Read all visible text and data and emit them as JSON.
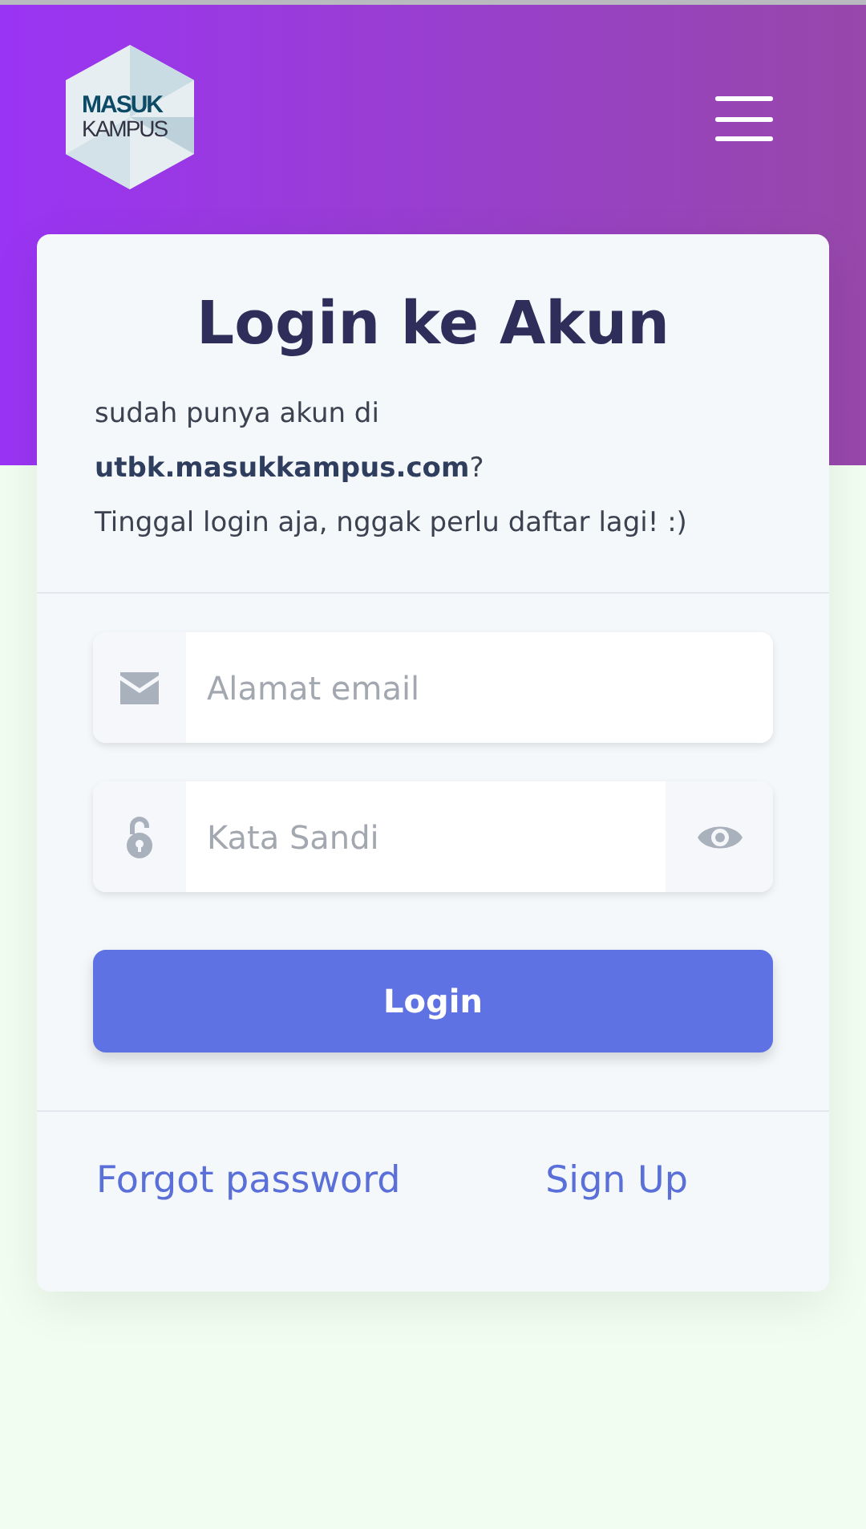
{
  "logo": {
    "lines": [
      "MASUK",
      "KAMPUS"
    ]
  },
  "title": "Login ke Akun",
  "intro": [
    "sudah punya akun di",
    "**utbk.masukkampus.com**?",
    "Tinggal login aja, nggak perlu daftar lagi! :)"
  ],
  "email_field": {
    "placeholder": "Alamat email"
  },
  "password_field": {
    "placeholder": "Kata Sandi"
  },
  "login_button": "Login",
  "links": [
    "Forgot password",
    "Sign Up"
  ]
}
